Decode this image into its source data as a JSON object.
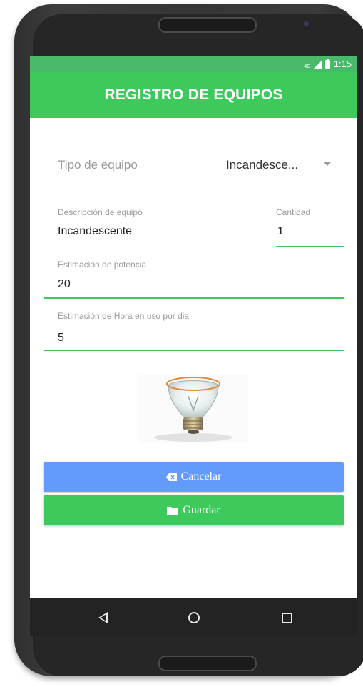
{
  "status_bar": {
    "network": "4G",
    "time": "1:15"
  },
  "app_bar": {
    "title": "REGISTRO DE EQUIPOS"
  },
  "form": {
    "tipo": {
      "label": "Tipo de equipo",
      "value": "Incandesce..."
    },
    "descripcion": {
      "label": "Descripción de equipo",
      "value": "Incandescente"
    },
    "cantidad": {
      "label": "Cantidad",
      "value": "1"
    },
    "potencia": {
      "label": "Estimación de potencia",
      "value": "20"
    },
    "horas": {
      "label": "Estimación de Hora en uso por dia",
      "value": "5"
    }
  },
  "buttons": {
    "cancel_label": "Cancelar",
    "save_label": "Guardar"
  },
  "icons": {
    "cancel": "backspace-icon",
    "save": "folder-icon",
    "bulb": "light-bulb-image"
  },
  "colors": {
    "status_bar": "#49b96c",
    "app_bar": "#3dc95b",
    "accent": "#3dc95b",
    "cancel_button": "#629bfb",
    "save_button": "#3dc95b"
  }
}
